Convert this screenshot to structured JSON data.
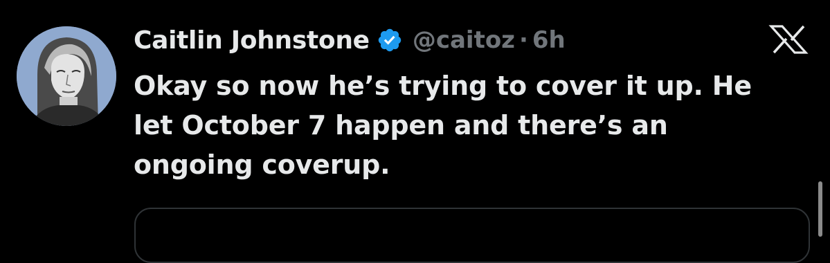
{
  "author": {
    "name": "Caitlin Johnstone",
    "handle": "@caitoz",
    "separator": "·",
    "time": "6h",
    "verified": true,
    "avatar_icon": "portrait-avatar"
  },
  "tweet": {
    "lines": [
      "Okay so now he’s trying to cover it up. He",
      "let October 7 happen and there’s an",
      "ongoing coverup."
    ]
  },
  "icons": {
    "verified": "verified-badge-icon",
    "platform": "x-logo-icon"
  },
  "colors": {
    "background": "#000000",
    "primary_text": "#e7e9ea",
    "secondary_text": "#71767b",
    "verified_blue": "#1d9bf0",
    "card_border": "#2f3336"
  }
}
